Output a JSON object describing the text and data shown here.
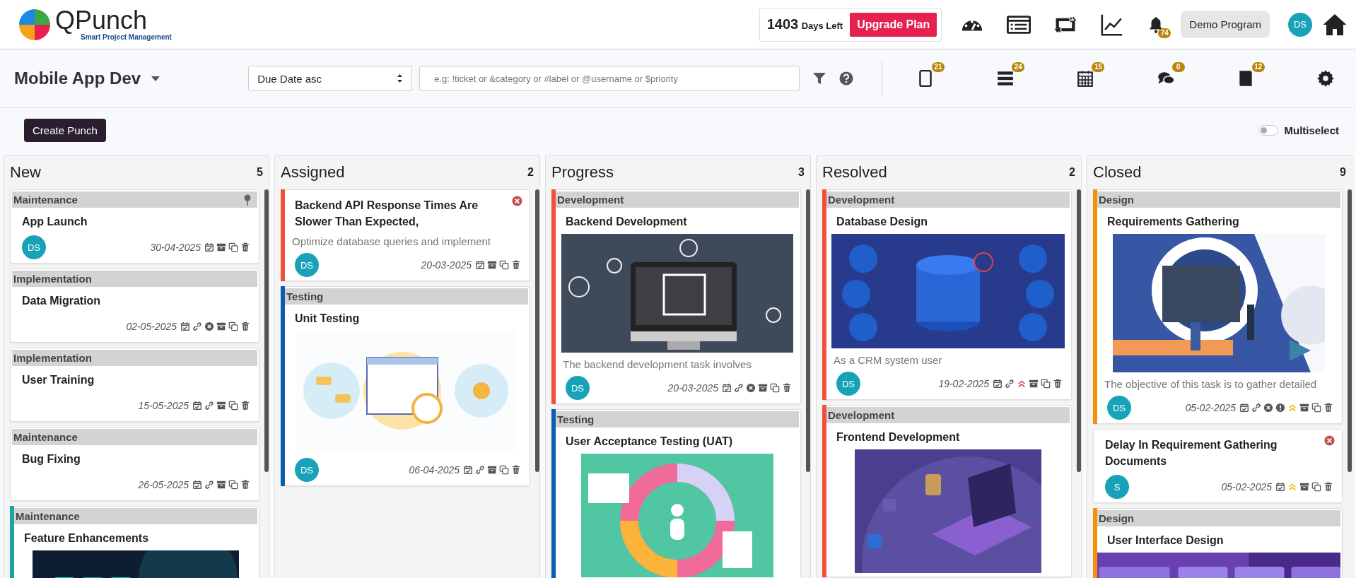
{
  "brand": {
    "name": "QPunch",
    "tagline": "Smart Project Management"
  },
  "plan": {
    "days": "1403",
    "days_label": "Days Left",
    "upgrade": "Upgrade Plan"
  },
  "notifications": {
    "count": "74"
  },
  "program": "Demo Program",
  "user": {
    "initials": "DS"
  },
  "project": {
    "name": "Mobile App Dev"
  },
  "sort": {
    "value": "Due Date asc"
  },
  "search": {
    "placeholder": "e.g: !ticket or &category or #label or @username or $priority"
  },
  "views": [
    {
      "kind": "tablet",
      "count": "21"
    },
    {
      "kind": "stack",
      "count": "24"
    },
    {
      "kind": "calendar",
      "count": "15"
    },
    {
      "kind": "comments",
      "count": "0"
    },
    {
      "kind": "book",
      "count": "12"
    }
  ],
  "create_button": "Create Punch",
  "multiselect": {
    "label": "Multiselect",
    "on": false
  },
  "columns": [
    {
      "title": "New",
      "count": "5",
      "cards": [
        {
          "category": "Maintenance",
          "pinned": true,
          "title": "App Launch",
          "assignee": "DS",
          "date": "30-04-2025",
          "actions": [
            {
              "kind": "checklist"
            },
            {
              "kind": "archive"
            },
            {
              "kind": "copy"
            },
            {
              "kind": "delete"
            }
          ]
        },
        {
          "category": "Implementation",
          "pinned": false,
          "title": "Data Migration",
          "date": "02-05-2025",
          "actions": [
            {
              "kind": "checklist"
            },
            {
              "kind": "link"
            },
            {
              "kind": "cancel"
            },
            {
              "kind": "archive"
            },
            {
              "kind": "copy"
            },
            {
              "kind": "delete"
            }
          ]
        },
        {
          "category": "Implementation",
          "pinned": false,
          "title": "User Training",
          "date": "15-05-2025",
          "actions": [
            {
              "kind": "checklist"
            },
            {
              "kind": "link"
            },
            {
              "kind": "archive"
            },
            {
              "kind": "copy"
            },
            {
              "kind": "delete"
            }
          ]
        },
        {
          "category": "Maintenance",
          "pinned": false,
          "title": "Bug Fixing",
          "date": "26-05-2025",
          "actions": [
            {
              "kind": "checklist"
            },
            {
              "kind": "link"
            },
            {
              "kind": "archive"
            },
            {
              "kind": "copy"
            },
            {
              "kind": "delete"
            }
          ]
        },
        {
          "category": "Maintenance",
          "pinned": false,
          "color": "#1aa6a0",
          "title": "Feature Enhancements",
          "media": {
            "kind": "picture"
          }
        }
      ]
    },
    {
      "title": "Assigned",
      "count": "2",
      "cards": [
        {
          "color": "#f1513c",
          "title": "Backend API Response Times Are Slower Than Expected,",
          "removable": true,
          "description": "Optimize database queries and implement",
          "assignee": "DS",
          "date": "20-03-2025",
          "actions": [
            {
              "kind": "checklist"
            },
            {
              "kind": "archive"
            },
            {
              "kind": "copy"
            },
            {
              "kind": "delete"
            }
          ]
        },
        {
          "category": "Testing",
          "pinned": false,
          "color": "#0c5dad",
          "title": "Unit Testing",
          "media": {
            "kind": "picture"
          },
          "assignee": "DS",
          "date": "06-04-2025",
          "actions": [
            {
              "kind": "checklist"
            },
            {
              "kind": "link"
            },
            {
              "kind": "archive"
            },
            {
              "kind": "copy"
            },
            {
              "kind": "delete"
            }
          ]
        }
      ]
    },
    {
      "title": "Progress",
      "count": "3",
      "cards": [
        {
          "category": "Development",
          "pinned": false,
          "color": "#f1513c",
          "title": "Backend Development",
          "media": {
            "kind": "picture"
          },
          "description": "The backend development task involves",
          "assignee": "DS",
          "date": "20-03-2025",
          "actions": [
            {
              "kind": "checklist"
            },
            {
              "kind": "link"
            },
            {
              "kind": "cancel"
            },
            {
              "kind": "archive"
            },
            {
              "kind": "copy"
            },
            {
              "kind": "delete"
            }
          ]
        },
        {
          "category": "Testing",
          "pinned": false,
          "color": "#0c5dad",
          "title": "User Acceptance Testing (UAT)",
          "media": {
            "kind": "picture"
          }
        }
      ]
    },
    {
      "title": "Resolved",
      "count": "2",
      "cards": [
        {
          "category": "Development",
          "pinned": false,
          "color": "#f1513c",
          "title": "Database Design",
          "media": {
            "kind": "picture"
          },
          "description": "As a CRM system user",
          "assignee": "DS",
          "date": "19-02-2025",
          "actions": [
            {
              "kind": "checklist"
            },
            {
              "kind": "link"
            },
            {
              "kind": "priority-high"
            },
            {
              "kind": "archive"
            },
            {
              "kind": "copy"
            },
            {
              "kind": "delete"
            }
          ]
        },
        {
          "category": "Development",
          "pinned": false,
          "color": "#f1513c",
          "title": "Frontend Development",
          "media": {
            "kind": "picture"
          }
        }
      ]
    },
    {
      "title": "Closed",
      "count": "9",
      "cards": [
        {
          "category": "Design",
          "pinned": false,
          "color": "#f7900a",
          "title": "Requirements Gathering",
          "media": {
            "kind": "picture"
          },
          "description": "The objective of this task is to gather detailed",
          "assignee": "DS",
          "date": "05-02-2025",
          "actions": [
            {
              "kind": "checklist"
            },
            {
              "kind": "link"
            },
            {
              "kind": "cancel"
            },
            {
              "kind": "alert"
            },
            {
              "kind": "priority-medium"
            },
            {
              "kind": "archive"
            },
            {
              "kind": "copy"
            },
            {
              "kind": "delete"
            }
          ]
        },
        {
          "title": "Delay In Requirement Gathering Documents",
          "removable": true,
          "assignee": "S",
          "date": "05-02-2025",
          "actions": [
            {
              "kind": "checklist"
            },
            {
              "kind": "priority-medium"
            },
            {
              "kind": "archive"
            },
            {
              "kind": "copy"
            },
            {
              "kind": "delete"
            }
          ]
        },
        {
          "category": "Design",
          "pinned": false,
          "color": "#f7900a",
          "title": "User Interface Design",
          "media": {
            "kind": "picture"
          }
        }
      ]
    }
  ]
}
